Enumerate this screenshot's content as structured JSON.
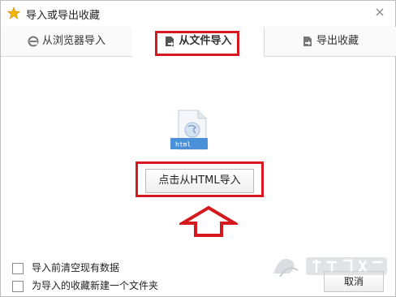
{
  "window": {
    "title": "导入或导出收藏",
    "close_glyph": "×"
  },
  "tabs": [
    {
      "label": "从浏览器导入",
      "icon": "browser-e-icon",
      "selected": false
    },
    {
      "label": "从文件导入",
      "icon": "file-import-icon",
      "selected": true
    },
    {
      "label": "导出收藏",
      "icon": "file-export-icon",
      "selected": false
    }
  ],
  "file_icon": {
    "label": "html",
    "icon": "html-file-icon"
  },
  "import_button": {
    "label": "点击从HTML导入"
  },
  "options": [
    {
      "label": "导入前清空现有数据",
      "checked": false
    },
    {
      "label": "为导入的收藏新建一个文件夹",
      "checked": false
    }
  ],
  "cancel_button": {
    "label": "取消"
  },
  "colors": {
    "highlight": "#d6181f",
    "file_badge": "#4a90d9",
    "star": "#f5b400"
  }
}
